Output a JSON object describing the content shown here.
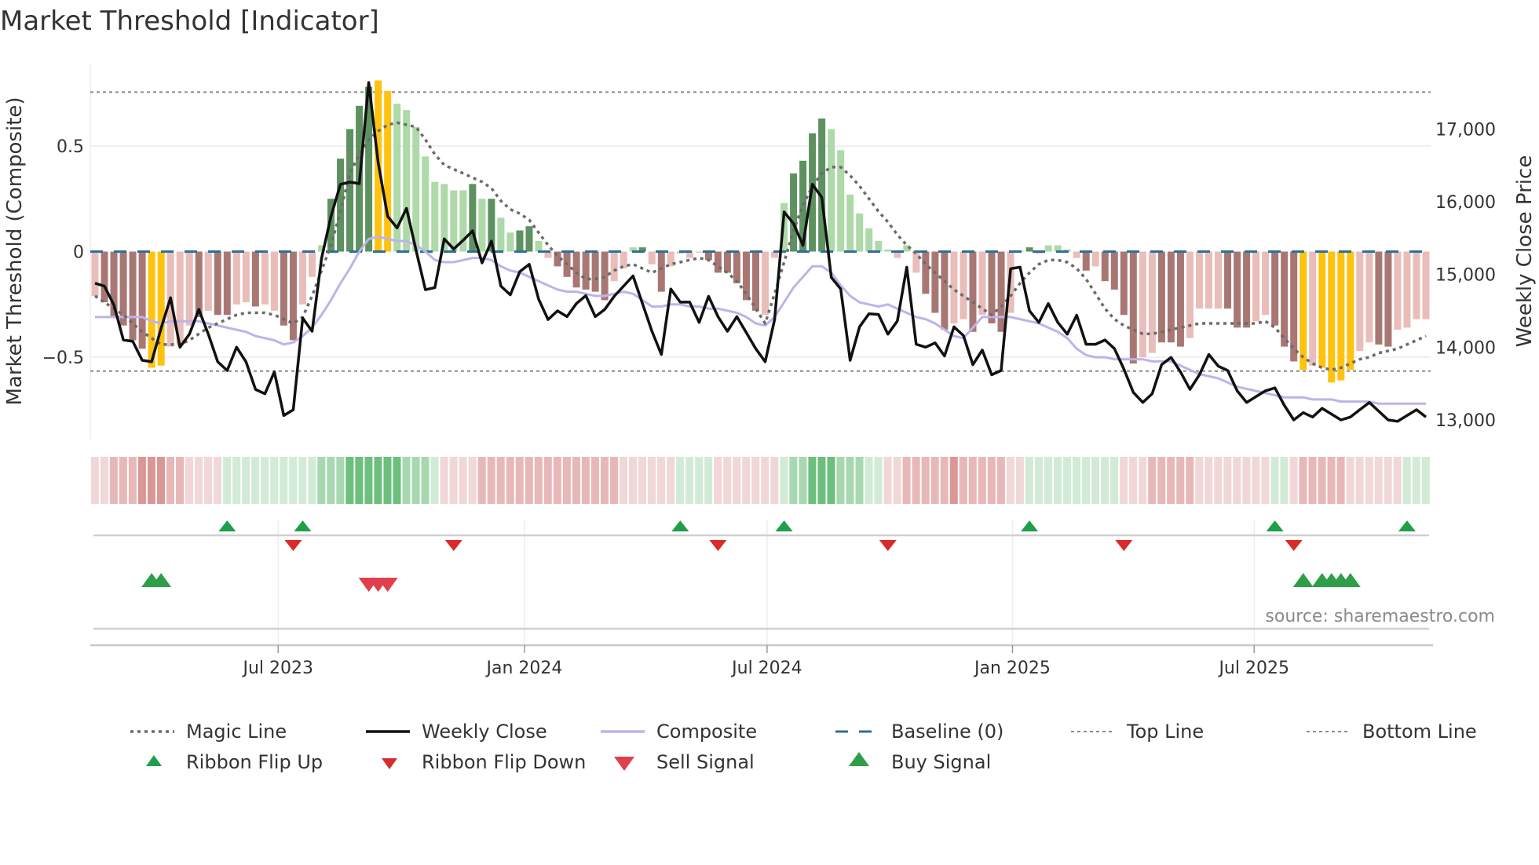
{
  "chart_data": {
    "type": "bar",
    "title": "Market Threshold [Indicator]",
    "ylabel_left": "Market Threshold (Composite)",
    "ylabel_right": "Weekly Close Price",
    "source": "source: sharemaestro.com",
    "weeks": 142,
    "ylim_left": [
      -0.89,
      0.89
    ],
    "ylim_right": [
      12730,
      17900
    ],
    "left_ticks": [
      {
        "value": 0.5,
        "label": "0.5"
      },
      {
        "value": 0,
        "label": "0"
      },
      {
        "value": -0.5,
        "label": "−0.5"
      }
    ],
    "right_ticks": [
      {
        "value": 17000,
        "label": "17,000"
      },
      {
        "value": 16000,
        "label": "16,000"
      },
      {
        "value": 15000,
        "label": "15,000"
      },
      {
        "value": 14000,
        "label": "14,000"
      },
      {
        "value": 13000,
        "label": "13,000"
      }
    ],
    "x_ticks": [
      {
        "week": 19.4,
        "label": "Jul 2023"
      },
      {
        "week": 45.5,
        "label": "Jan 2024"
      },
      {
        "week": 71.2,
        "label": "Jul 2024"
      },
      {
        "week": 97.2,
        "label": "Jan 2025"
      },
      {
        "week": 122.8,
        "label": "Jul 2025"
      }
    ],
    "top_line": 0.755,
    "bottom_line": -0.566,
    "baseline": 0,
    "colors": {
      "DR": "#a97773",
      "LR": "#e9bdb9",
      "DG": "#5d9160",
      "LG": "#aed9a8",
      "Y": "#ffc20e",
      "close": "#111111",
      "composite": "#bcb4ea",
      "magic": "#6b6b6b",
      "baseline": "#2f6f96",
      "threshold": "#8a8a8a",
      "flip_up": "#1f9e4b",
      "flip_down": "#d92b2b",
      "sell": "#e0404c",
      "buy": "#2e9e48",
      "ribbon_pos": [
        "#d2ebd6",
        "#a7d8b0",
        "#6cbf7c",
        "#3ea454"
      ],
      "ribbon_neg": [
        "#f1d7d7",
        "#e8b8b8",
        "#d99796"
      ]
    },
    "histogram": {
      "values": [
        -0.21,
        -0.24,
        -0.31,
        -0.35,
        -0.42,
        -0.46,
        -0.55,
        -0.54,
        -0.45,
        -0.44,
        -0.35,
        -0.31,
        -0.28,
        -0.3,
        -0.3,
        -0.25,
        -0.24,
        -0.26,
        -0.25,
        -0.28,
        -0.35,
        -0.42,
        -0.25,
        -0.12,
        0.03,
        0.25,
        0.44,
        0.58,
        0.69,
        0.78,
        0.81,
        0.76,
        0.7,
        0.67,
        0.59,
        0.45,
        0.33,
        0.32,
        0.29,
        0.29,
        0.32,
        0.25,
        0.25,
        0.16,
        0.09,
        0.1,
        0.12,
        0.05,
        -0.03,
        -0.07,
        -0.12,
        -0.17,
        -0.18,
        -0.19,
        -0.23,
        -0.14,
        -0.08,
        0.02,
        0.02,
        -0.06,
        -0.19,
        -0.07,
        -0.01,
        -0.03,
        -0.005,
        -0.04,
        -0.1,
        -0.1,
        -0.15,
        -0.23,
        -0.28,
        -0.3,
        -0.03,
        0.23,
        0.37,
        0.43,
        0.56,
        0.63,
        0.58,
        0.48,
        0.27,
        0.18,
        0.11,
        0.05,
        0.01,
        -0.03,
        0.03,
        -0.1,
        -0.2,
        -0.29,
        -0.37,
        -0.34,
        -0.32,
        -0.38,
        -0.3,
        -0.34,
        -0.38,
        -0.29,
        0.005,
        0.02,
        -0.01,
        0.03,
        0.03,
        0.01,
        -0.03,
        -0.09,
        -0.07,
        -0.14,
        -0.18,
        -0.3,
        -0.53,
        -0.5,
        -0.48,
        -0.43,
        -0.43,
        -0.45,
        -0.41,
        -0.27,
        -0.27,
        -0.27,
        -0.27,
        -0.36,
        -0.36,
        -0.33,
        -0.3,
        -0.35,
        -0.45,
        -0.52,
        -0.56,
        -0.54,
        -0.55,
        -0.62,
        -0.61,
        -0.56,
        -0.47,
        -0.43,
        -0.44,
        -0.45,
        -0.37,
        -0.36,
        -0.32,
        -0.32
      ],
      "colors": [
        "LR",
        "DR",
        "DR",
        "DR",
        "DR",
        "DR",
        "Y",
        "Y",
        "LR",
        "LR",
        "LR",
        "DR",
        "LR",
        "DR",
        "DR",
        "LR",
        "LR",
        "DR",
        "LR",
        "LR",
        "DR",
        "DR",
        "LR",
        "LR",
        "LG",
        "DG",
        "DG",
        "DG",
        "DG",
        "DG",
        "Y",
        "Y",
        "LG",
        "LG",
        "LG",
        "LG",
        "LG",
        "LG",
        "LG",
        "LG",
        "DG",
        "LG",
        "DG",
        "LG",
        "LG",
        "DG",
        "DG",
        "LG",
        "LR",
        "DR",
        "DR",
        "DR",
        "DR",
        "DR",
        "DR",
        "LR",
        "LR",
        "LG",
        "DG",
        "LR",
        "DR",
        "LR",
        "LR",
        "LR",
        "LR",
        "DR",
        "DR",
        "DR",
        "DR",
        "DR",
        "DR",
        "LR",
        "LR",
        "LG",
        "DG",
        "DG",
        "DG",
        "DG",
        "LG",
        "LG",
        "LG",
        "LG",
        "LG",
        "LG",
        "LG",
        "LR",
        "LG",
        "LR",
        "DR",
        "DR",
        "DR",
        "LR",
        "LR",
        "DR",
        "LR",
        "DR",
        "DR",
        "LR",
        "LG",
        "DG",
        "LR",
        "LG",
        "LG",
        "LG",
        "LR",
        "DR",
        "LR",
        "DR",
        "DR",
        "DR",
        "DR",
        "LR",
        "LR",
        "DR",
        "DR",
        "DR",
        "LR",
        "LR",
        "LR",
        "LR",
        "DR",
        "DR",
        "DR",
        "LR",
        "LR",
        "DR",
        "DR",
        "DR",
        "Y",
        "LR",
        "Y",
        "Y",
        "Y",
        "Y",
        "LR",
        "LR",
        "DR",
        "DR",
        "LR",
        "LR",
        "LR",
        "LR"
      ]
    },
    "weekly_close": [
      14880,
      14840,
      14580,
      14100,
      14080,
      13820,
      13800,
      14260,
      14680,
      14000,
      14180,
      14520,
      14180,
      13800,
      13680,
      14000,
      13800,
      13420,
      13360,
      13660,
      13060,
      13140,
      14400,
      14220,
      15220,
      15800,
      16240,
      16270,
      16250,
      17640,
      16540,
      15800,
      15640,
      15910,
      15340,
      14790,
      14820,
      15490,
      15350,
      15470,
      15600,
      15160,
      15460,
      14840,
      14720,
      15040,
      15140,
      14660,
      14380,
      14500,
      14420,
      14600,
      14710,
      14420,
      14520,
      14700,
      14840,
      14980,
      14600,
      14220,
      13900,
      14800,
      14620,
      14620,
      14340,
      14700,
      14420,
      14220,
      14420,
      14200,
      13980,
      13800,
      14380,
      15860,
      15700,
      15400,
      16240,
      16060,
      14960,
      14800,
      13820,
      14280,
      14460,
      14450,
      14180,
      14360,
      15100,
      14040,
      14000,
      14060,
      13880,
      14280,
      14160,
      13760,
      13960,
      13620,
      13680,
      15080,
      15100,
      14500,
      14340,
      14600,
      14340,
      14180,
      14440,
      14040,
      14040,
      14100,
      13980,
      13700,
      13380,
      13240,
      13360,
      13760,
      13860,
      13660,
      13420,
      13620,
      13900,
      13740,
      13680,
      13400,
      13240,
      13320,
      13400,
      13440,
      13200,
      13000,
      13100,
      13040,
      13160,
      13080,
      13000,
      13040,
      13140,
      13240,
      13120,
      13000,
      12980,
      13060,
      13140,
      13040
    ],
    "magic_line": [
      -0.21,
      -0.24,
      -0.27,
      -0.3,
      -0.34,
      -0.38,
      -0.41,
      -0.44,
      -0.44,
      -0.44,
      -0.42,
      -0.39,
      -0.36,
      -0.34,
      -0.32,
      -0.3,
      -0.29,
      -0.29,
      -0.29,
      -0.3,
      -0.32,
      -0.34,
      -0.31,
      -0.21,
      -0.09,
      0.03,
      0.19,
      0.37,
      0.46,
      0.53,
      0.57,
      0.6,
      0.61,
      0.6,
      0.59,
      0.53,
      0.46,
      0.41,
      0.39,
      0.37,
      0.35,
      0.33,
      0.3,
      0.24,
      0.2,
      0.18,
      0.15,
      0.09,
      0.03,
      -0.02,
      -0.06,
      -0.1,
      -0.13,
      -0.13,
      -0.12,
      -0.09,
      -0.07,
      -0.06,
      -0.08,
      -0.1,
      -0.08,
      -0.06,
      -0.05,
      -0.04,
      -0.03,
      -0.04,
      -0.07,
      -0.1,
      -0.14,
      -0.2,
      -0.27,
      -0.34,
      -0.2,
      -0.05,
      0.1,
      0.22,
      0.31,
      0.37,
      0.4,
      0.4,
      0.36,
      0.31,
      0.25,
      0.19,
      0.14,
      0.08,
      0.03,
      -0.01,
      -0.06,
      -0.1,
      -0.14,
      -0.18,
      -0.21,
      -0.24,
      -0.27,
      -0.3,
      -0.26,
      -0.21,
      -0.15,
      -0.1,
      -0.06,
      -0.04,
      -0.04,
      -0.05,
      -0.08,
      -0.13,
      -0.2,
      -0.27,
      -0.32,
      -0.35,
      -0.37,
      -0.39,
      -0.39,
      -0.38,
      -0.37,
      -0.36,
      -0.35,
      -0.34,
      -0.34,
      -0.34,
      -0.34,
      -0.34,
      -0.34,
      -0.34,
      -0.33,
      -0.36,
      -0.41,
      -0.46,
      -0.5,
      -0.53,
      -0.55,
      -0.56,
      -0.55,
      -0.53,
      -0.51,
      -0.5,
      -0.48,
      -0.47,
      -0.46,
      -0.44,
      -0.42,
      -0.4
    ],
    "composite": [
      -0.31,
      -0.31,
      -0.31,
      -0.31,
      -0.31,
      -0.31,
      -0.33,
      -0.34,
      -0.33,
      -0.33,
      -0.33,
      -0.33,
      -0.34,
      -0.35,
      -0.36,
      -0.37,
      -0.38,
      -0.4,
      -0.41,
      -0.42,
      -0.44,
      -0.43,
      -0.4,
      -0.36,
      -0.3,
      -0.23,
      -0.15,
      -0.08,
      0.0,
      0.06,
      0.07,
      0.06,
      0.05,
      0.05,
      0.03,
      0.0,
      -0.04,
      -0.05,
      -0.05,
      -0.04,
      -0.03,
      -0.03,
      -0.04,
      -0.07,
      -0.09,
      -0.1,
      -0.12,
      -0.14,
      -0.16,
      -0.18,
      -0.19,
      -0.19,
      -0.2,
      -0.21,
      -0.21,
      -0.2,
      -0.19,
      -0.2,
      -0.23,
      -0.26,
      -0.26,
      -0.25,
      -0.25,
      -0.26,
      -0.26,
      -0.27,
      -0.27,
      -0.28,
      -0.29,
      -0.31,
      -0.34,
      -0.35,
      -0.31,
      -0.24,
      -0.17,
      -0.12,
      -0.07,
      -0.07,
      -0.1,
      -0.16,
      -0.21,
      -0.24,
      -0.25,
      -0.26,
      -0.25,
      -0.27,
      -0.29,
      -0.31,
      -0.32,
      -0.34,
      -0.37,
      -0.4,
      -0.41,
      -0.36,
      -0.31,
      -0.31,
      -0.31,
      -0.31,
      -0.32,
      -0.33,
      -0.34,
      -0.36,
      -0.38,
      -0.41,
      -0.46,
      -0.49,
      -0.5,
      -0.5,
      -0.51,
      -0.51,
      -0.51,
      -0.51,
      -0.52,
      -0.52,
      -0.52,
      -0.54,
      -0.56,
      -0.58,
      -0.59,
      -0.6,
      -0.62,
      -0.64,
      -0.65,
      -0.66,
      -0.67,
      -0.68,
      -0.69,
      -0.69,
      -0.69,
      -0.7,
      -0.7,
      -0.7,
      -0.71,
      -0.71,
      -0.71,
      -0.71,
      -0.72,
      -0.72,
      -0.72,
      -0.72,
      -0.72,
      -0.72
    ],
    "ribbon": [
      -1,
      -1,
      -2,
      -2,
      -2,
      -3,
      -3,
      -3,
      -2,
      -2,
      -1,
      -1,
      -1,
      -1,
      1,
      1,
      1,
      1,
      1,
      1,
      1,
      1,
      1,
      1,
      2,
      2,
      2,
      3,
      3,
      3,
      3,
      3,
      3,
      2,
      2,
      2,
      1,
      -1,
      -1,
      -1,
      -1,
      -2,
      -2,
      -2,
      -2,
      -2,
      -2,
      -2,
      -2,
      -2,
      -2,
      -2,
      -2,
      -2,
      -2,
      -2,
      -1,
      -1,
      -1,
      -1,
      -1,
      -1,
      1,
      1,
      1,
      1,
      -1,
      -1,
      -1,
      -1,
      -1,
      -1,
      -1,
      1,
      2,
      2,
      3,
      3,
      3,
      2,
      2,
      2,
      1,
      1,
      -1,
      -1,
      -2,
      -2,
      -2,
      -2,
      -2,
      -3,
      -2,
      -2,
      -2,
      -2,
      -2,
      -1,
      -1,
      1,
      1,
      1,
      1,
      1,
      1,
      1,
      1,
      1,
      1,
      -1,
      -1,
      -1,
      -2,
      -2,
      -2,
      -2,
      -2,
      -1,
      -1,
      -1,
      -1,
      -1,
      -1,
      -1,
      -1,
      1,
      1,
      -1,
      -2,
      -2,
      -2,
      -2,
      -2,
      -1,
      -1,
      -1,
      -1,
      -1,
      -1,
      1,
      1,
      1
    ],
    "ribbon_flip_up": [
      14,
      22,
      62,
      73,
      99,
      125,
      139
    ],
    "ribbon_flip_down": [
      21,
      38,
      66,
      84,
      109,
      127
    ],
    "buy_signal": [
      6,
      7,
      128,
      130,
      131,
      132,
      133
    ],
    "sell_signal": [
      29,
      30,
      31
    ],
    "legend": [
      {
        "label": "Magic Line",
        "kind": "magic"
      },
      {
        "label": "Weekly Close",
        "kind": "close"
      },
      {
        "label": "Composite",
        "kind": "composite"
      },
      {
        "label": "Baseline (0)",
        "kind": "baseline"
      },
      {
        "label": "Top Line",
        "kind": "threshold"
      },
      {
        "label": "Bottom Line",
        "kind": "threshold"
      },
      {
        "label": "Ribbon Flip Up",
        "kind": "flip_up"
      },
      {
        "label": "Ribbon Flip Down",
        "kind": "flip_down"
      },
      {
        "label": "Sell Signal",
        "kind": "sell"
      },
      {
        "label": "Buy Signal",
        "kind": "buy"
      }
    ]
  }
}
